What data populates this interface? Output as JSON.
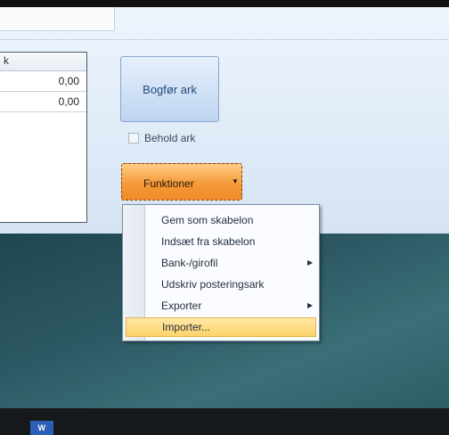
{
  "grid": {
    "header_text": "k",
    "rows": [
      {
        "value": "0,00"
      },
      {
        "value": "0,00"
      }
    ]
  },
  "buttons": {
    "bogfor_label": "Bogfør ark",
    "funktioner_label": "Funktioner"
  },
  "checkbox": {
    "behold_label": "Behold ark",
    "checked": false
  },
  "menu": {
    "items": [
      {
        "label": "Gem som skabelon",
        "submenu": false
      },
      {
        "label": "Indsæt fra skabelon",
        "submenu": false
      },
      {
        "label": "Bank-/girofil",
        "submenu": true
      },
      {
        "label": "Udskriv posteringsark",
        "submenu": false
      },
      {
        "label": "Exporter",
        "submenu": true
      },
      {
        "label": "Importer...",
        "submenu": false,
        "highlighted": true
      }
    ]
  },
  "taskbar": {
    "word_icon_text": "W"
  },
  "colors": {
    "accent_orange": "#f59a3a",
    "menu_highlight": "#fdd46a",
    "button_blue": "#bed4f0"
  }
}
